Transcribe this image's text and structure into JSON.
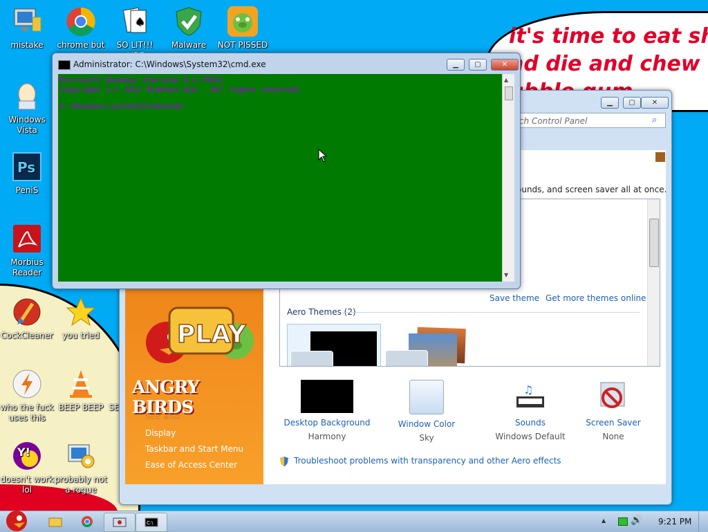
{
  "bubble": {
    "line1": "it's time to eat shi",
    "line2": "nd die and chew",
    "line3": "ubble gum"
  },
  "desktop_icons": [
    {
      "label": "mistake",
      "icon": "computer-icon"
    },
    {
      "label": "chrome but",
      "icon": "chrome-icon"
    },
    {
      "label": "SO LIT!!! AIRE",
      "icon": "solitaire-icon"
    },
    {
      "label": "Malware",
      "icon": "shield-icon"
    },
    {
      "label": "NOT PISSED",
      "icon": "angry-birds-pig-icon"
    },
    {
      "label": "Windows Vista",
      "icon": "egg-icon"
    },
    {
      "label": "PeniS",
      "icon": "photoshop-icon"
    },
    {
      "label": "Morbius Reader",
      "icon": "pdf-reader-icon"
    },
    {
      "label": "CockCleaner",
      "icon": "ccleaner-icon"
    },
    {
      "label": "you tried",
      "icon": "star-icon"
    },
    {
      "label": "who the fuck uses this",
      "icon": "winamp-icon"
    },
    {
      "label": "BEEP BEEP",
      "icon": "vlc-icon"
    },
    {
      "label": "doesn't work lol",
      "icon": "yahoo-icon"
    },
    {
      "label": "probably not a rogue",
      "icon": "antivirus-icon"
    },
    {
      "label": "SE",
      "icon": "partial-icon"
    }
  ],
  "cmd": {
    "title": "Administrator: C:\\Windows\\System32\\cmd.exe",
    "line1": "Microsoft Windows [Version 6.1.7601]",
    "line2": "Copyright (c) 2012 Bikehut Kyo.  All rights reserved.",
    "line3": "C:\\Windows\\system32>mounten"
  },
  "control_panel": {
    "search_placeholder": "rch Control Panel",
    "intro": "ounds, and screen saver all at once.",
    "save_theme": "Save theme",
    "get_more": "Get more themes online",
    "aero_themes": "Aero Themes (2)",
    "play_label": "PLAY",
    "brand": "ANGRY BIRDS",
    "see_also": "See also",
    "sidebar_links": [
      "Display",
      "Taskbar and Start Menu",
      "Ease of Access Center"
    ],
    "settings": [
      {
        "label": "Desktop Background",
        "value": "Harmony",
        "icon": "desktop-background-icon"
      },
      {
        "label": "Window Color",
        "value": "Sky",
        "icon": "window-color-icon"
      },
      {
        "label": "Sounds",
        "value": "Windows Default",
        "icon": "sounds-icon"
      },
      {
        "label": "Screen Saver",
        "value": "None",
        "icon": "screen-saver-icon"
      }
    ],
    "troubleshoot": "Troubleshoot problems with transparency and other Aero effects"
  },
  "taskbar": {
    "time": "9:21 PM",
    "items": [
      "start-orb-angry-bird-icon",
      "explorer-icon",
      "chrome-icon",
      "control-panel-icon",
      "cmd-icon"
    ]
  },
  "colors": {
    "desktop": "#00aaf4",
    "console_bg": "#007a00",
    "console_text": "#7a1faa",
    "bubble_text": "#e0002a"
  }
}
